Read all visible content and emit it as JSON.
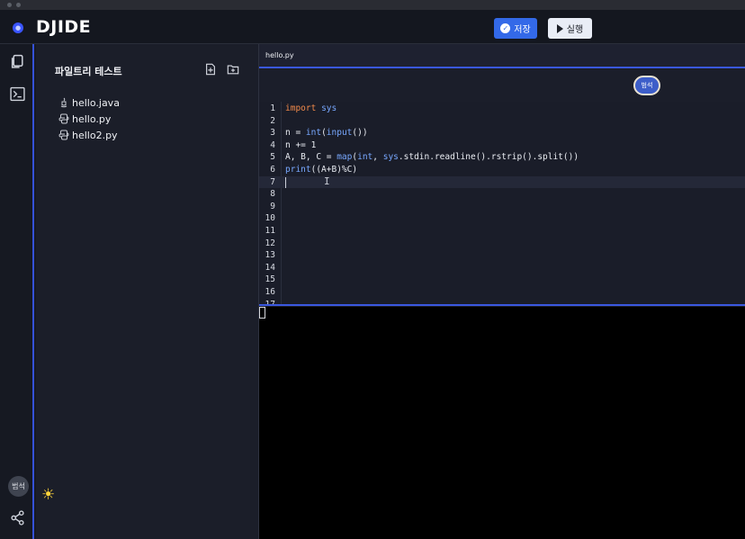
{
  "app": {
    "brand": "DJIDE",
    "save_label": "저장",
    "run_label": "실행",
    "accent_color": "#3369e8"
  },
  "sidebar": {
    "icons": [
      "files-icon",
      "terminal-icon",
      "share-icon",
      "sun-icon"
    ],
    "avatar_label": "범석"
  },
  "explorer": {
    "title": "파일트리 테스트",
    "files": [
      {
        "name": "hello.java",
        "icon": "java-icon"
      },
      {
        "name": "hello.py",
        "icon": "python-icon"
      },
      {
        "name": "hello2.py",
        "icon": "python-icon"
      }
    ]
  },
  "editor": {
    "tab_label": "hello.py",
    "presence_label": "범석",
    "active_line": 7,
    "lines": [
      {
        "n": "1",
        "text": "import sys"
      },
      {
        "n": "2",
        "text": ""
      },
      {
        "n": "3",
        "text": "n = int(input())"
      },
      {
        "n": "4",
        "text": "n += 1"
      },
      {
        "n": "5",
        "text": "A, B, C = map(int, sys.stdin.readline().rstrip().split())"
      },
      {
        "n": "6",
        "text": "print((A+B)%C)"
      },
      {
        "n": "7",
        "text": ""
      },
      {
        "n": "8",
        "text": ""
      },
      {
        "n": "9",
        "text": ""
      },
      {
        "n": "10",
        "text": ""
      },
      {
        "n": "11",
        "text": ""
      },
      {
        "n": "12",
        "text": ""
      },
      {
        "n": "13",
        "text": ""
      },
      {
        "n": "14",
        "text": ""
      },
      {
        "n": "15",
        "text": ""
      },
      {
        "n": "16",
        "text": ""
      },
      {
        "n": "17",
        "text": ""
      }
    ]
  }
}
